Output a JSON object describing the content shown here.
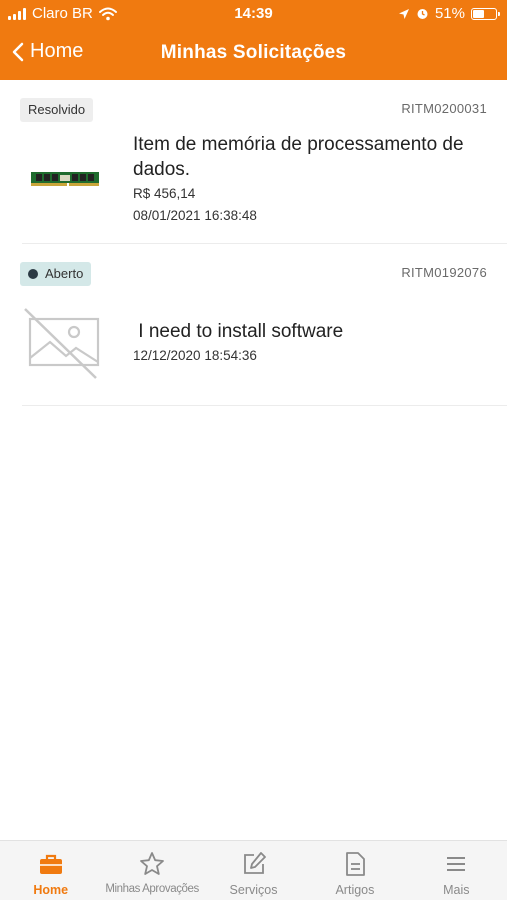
{
  "status_bar": {
    "carrier": "Claro BR",
    "time": "14:39",
    "battery": "51%",
    "battery_level": 0.51,
    "icons": [
      "signal-icon",
      "wifi-icon",
      "location-icon",
      "alarm-icon",
      "battery-icon"
    ]
  },
  "header": {
    "back_label": "Home",
    "title": "Minhas Solicitações",
    "color": "#f07a10"
  },
  "requests": [
    {
      "status": "Resolvido",
      "number": "RITM0200031",
      "title": "Item de memória de processamento de dados.",
      "price": "R$ 456,14",
      "date": "08/01/2021 16:38:48",
      "image": "ram-module-image"
    },
    {
      "status": "Aberto",
      "number": "RITM0192076",
      "title": " I need to install software",
      "date": "12/12/2020 18:54:36",
      "image": "no-image-placeholder-icon"
    }
  ],
  "tabs": [
    {
      "label": "Home",
      "icon": "briefcase-icon",
      "active": true
    },
    {
      "label": "Minhas Aprovações",
      "icon": "star-icon",
      "active": false
    },
    {
      "label": "Serviços",
      "icon": "edit-icon",
      "active": false
    },
    {
      "label": "Artigos",
      "icon": "document-icon",
      "active": false
    },
    {
      "label": "Mais",
      "icon": "menu-icon",
      "active": false
    }
  ],
  "colors": {
    "accent": "#f07a10",
    "badge_resolved_bg": "#eeeeee",
    "badge_open_bg": "#d4e8e8"
  }
}
